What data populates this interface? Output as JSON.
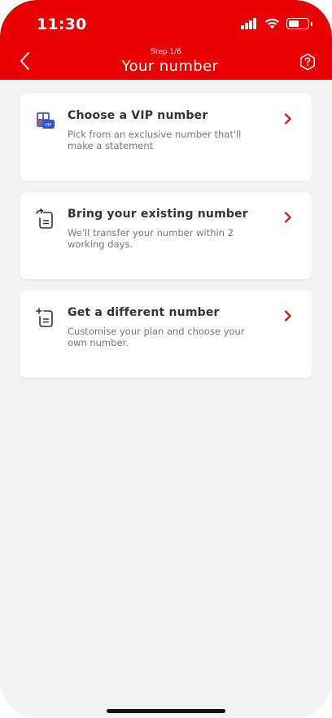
{
  "status_bar": {
    "time": "11:30"
  },
  "header": {
    "step": "Step 1/6",
    "title": "Your number"
  },
  "options": [
    {
      "title": "Choose a VIP number",
      "description": "Pick from an exclusive number that'll make a statement",
      "icon": "vip-number-icon"
    },
    {
      "title": "Bring your existing number",
      "description": "We'll transfer your number within 2 working days.",
      "icon": "sim-transfer-icon"
    },
    {
      "title": "Get a different number",
      "description": "Customise your plan and choose your own number.",
      "icon": "sim-new-icon"
    }
  ],
  "colors": {
    "brand": "#e60000",
    "background": "#f2f2f2",
    "text": "#333333",
    "muted": "#777777"
  }
}
